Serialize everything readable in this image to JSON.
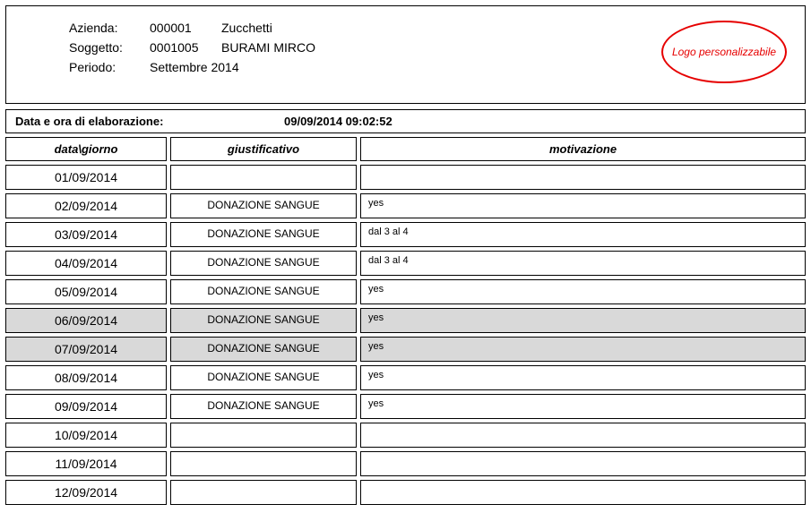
{
  "header": {
    "azienda_label": "Azienda:",
    "azienda_code": "000001",
    "azienda_name": "Zucchetti",
    "soggetto_label": "Soggetto:",
    "soggetto_code": "0001005",
    "soggetto_name": "BURAMI MIRCO",
    "periodo_label": "Periodo:",
    "periodo_value": "Settembre 2014",
    "logo_text": "Logo personalizzabile"
  },
  "elab": {
    "label": "Data e ora di elaborazione:",
    "value": "09/09/2014 09:02:52"
  },
  "columns": {
    "c1": "data\\giorno",
    "c2": "giustificativo",
    "c3": "motivazione"
  },
  "rows": [
    {
      "date": "01/09/2014",
      "giust": "",
      "motiv": "",
      "shaded": false
    },
    {
      "date": "02/09/2014",
      "giust": "DONAZIONE SANGUE",
      "motiv": "yes",
      "shaded": false
    },
    {
      "date": "03/09/2014",
      "giust": "DONAZIONE SANGUE",
      "motiv": "dal 3 al 4",
      "shaded": false
    },
    {
      "date": "04/09/2014",
      "giust": "DONAZIONE SANGUE",
      "motiv": "dal 3 al 4",
      "shaded": false
    },
    {
      "date": "05/09/2014",
      "giust": "DONAZIONE SANGUE",
      "motiv": "yes",
      "shaded": false
    },
    {
      "date": "06/09/2014",
      "giust": "DONAZIONE SANGUE",
      "motiv": "yes",
      "shaded": true
    },
    {
      "date": "07/09/2014",
      "giust": "DONAZIONE SANGUE",
      "motiv": "yes",
      "shaded": true
    },
    {
      "date": "08/09/2014",
      "giust": "DONAZIONE SANGUE",
      "motiv": "yes",
      "shaded": false
    },
    {
      "date": "09/09/2014",
      "giust": "DONAZIONE SANGUE",
      "motiv": "yes",
      "shaded": false
    },
    {
      "date": "10/09/2014",
      "giust": "",
      "motiv": "",
      "shaded": false
    },
    {
      "date": "11/09/2014",
      "giust": "",
      "motiv": "",
      "shaded": false
    },
    {
      "date": "12/09/2014",
      "giust": "",
      "motiv": "",
      "shaded": false
    }
  ]
}
